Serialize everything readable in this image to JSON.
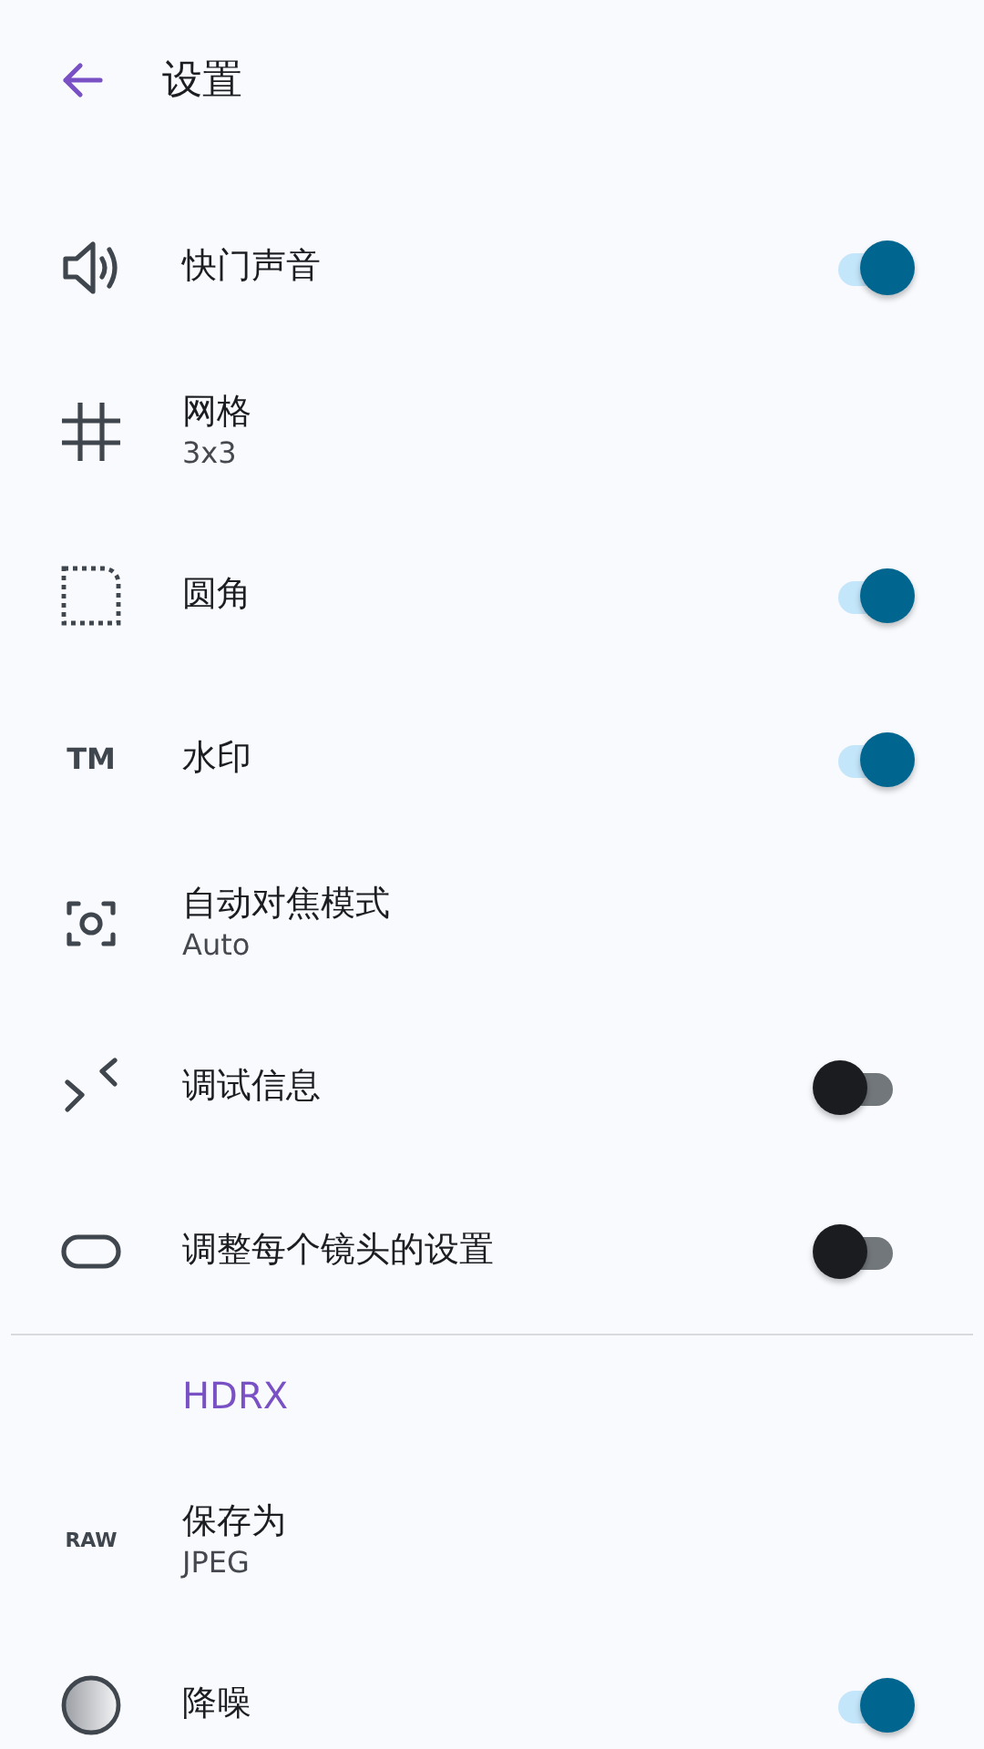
{
  "header": {
    "title": "设置"
  },
  "items": [
    {
      "label": "快门声音",
      "kind": "toggle",
      "on": true
    },
    {
      "label": "网格",
      "kind": "value",
      "value": "3x3"
    },
    {
      "label": "圆角",
      "kind": "toggle",
      "on": true
    },
    {
      "icon_text": "TM",
      "label": "水印",
      "kind": "toggle",
      "on": true
    },
    {
      "label": "自动对焦模式",
      "kind": "value",
      "value": "Auto"
    },
    {
      "label": "调试信息",
      "kind": "toggle",
      "on": false
    },
    {
      "label": "调整每个镜头的设置",
      "kind": "toggle",
      "on": false
    }
  ],
  "section": {
    "title": "HDRX",
    "items": [
      {
        "icon_text": "RAW",
        "label": "保存为",
        "kind": "value",
        "value": "JPEG"
      },
      {
        "label": "降噪",
        "kind": "toggle",
        "on": true
      }
    ]
  }
}
